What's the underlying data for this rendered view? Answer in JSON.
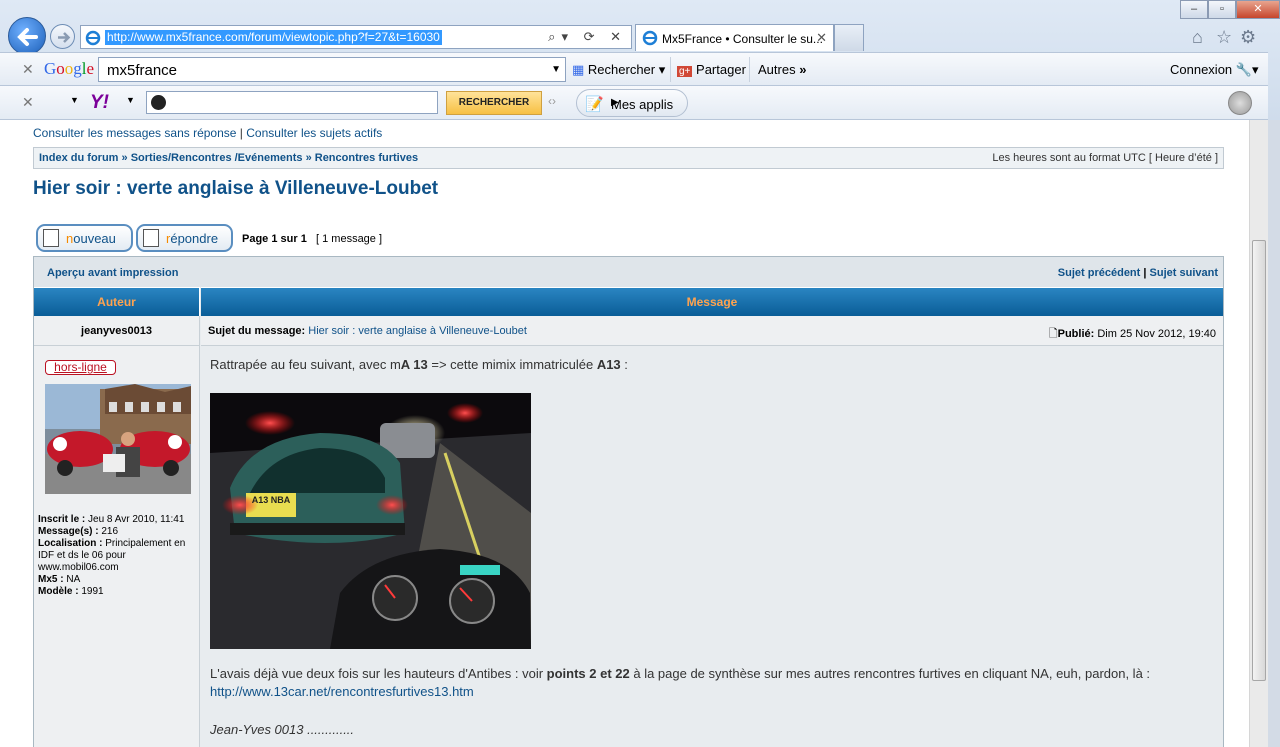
{
  "browser": {
    "url": "http://www.mx5france.com/forum/viewtopic.php?f=27&t=16030",
    "tab_title": "Mx5France • Consulter le su...",
    "google": {
      "search_value": "mx5france",
      "rechercher": "Rechercher",
      "partager": "Partager",
      "autres": "Autres",
      "connexion": "Connexion"
    },
    "yahoo": {
      "logo": "Y!",
      "button": "RECHERCHER",
      "apps": "Mes applis"
    }
  },
  "forum": {
    "links": {
      "unanswered": "Consulter les messages sans réponse",
      "active": "Consulter les sujets actifs",
      "sep": "|"
    },
    "breadcrumb": {
      "index": "Index du forum",
      "cat": "Sorties/Rencontres /Evénements",
      "sub": "Rencontres furtives",
      "sep": "»"
    },
    "timezone": "Les heures sont au format UTC [ Heure d’été ]",
    "topic_title": "Hier soir : verte anglaise à Villeneuve-Loubet",
    "buttons": {
      "new_first": "n",
      "new_rest": "ouveau",
      "reply_first": "r",
      "reply_rest": "épondre"
    },
    "page": {
      "label": "Page 1 sur 1",
      "count": "[ 1 message ]"
    },
    "print": "Aperçu avant impression",
    "prev": "Sujet précédent",
    "next": "Sujet suivant",
    "pipe": "|",
    "col_author": "Auteur",
    "col_message": "Message",
    "author": "jeanyves0013",
    "subject_label": "Sujet du message:",
    "subject": "Hier soir : verte anglaise à Villeneuve-Loubet",
    "posted_label": "Publié:",
    "posted": "Dim 25 Nov 2012, 19:40",
    "status": "hors-ligne",
    "profile": [
      {
        "k": "Inscrit le :",
        "v": "Jeu 8 Avr 2010, 11:41"
      },
      {
        "k": "Message(s) :",
        "v": "216"
      },
      {
        "k": "Localisation :",
        "v": "Principalement en IDF et ds le 06 pour www.mobil06.com"
      },
      {
        "k": "Mx5 :",
        "v": "NA"
      },
      {
        "k": "Modèle :",
        "v": "1991"
      }
    ],
    "body_line1_a": "Rattrapée au feu suivant, avec m",
    "body_line1_b": "A 13",
    "body_line1_c": " => cette mimix immatriculée ",
    "body_line1_d": "A13",
    "body_line1_e": " :",
    "plate": "A13 NBA",
    "body_line2_a": "L'avais déjà vue deux fois sur les hauteurs d'Antibes : voir ",
    "body_line2_b": "points 2 et 22",
    "body_line2_c": " à la page de synthèse sur mes autres rencontres furtives en cliquant NA, euh, pardon, là :",
    "body_link": "http://www.13car.net/rencontresfurtives13.htm",
    "signature": "Jean-Yves 0013 ............."
  }
}
